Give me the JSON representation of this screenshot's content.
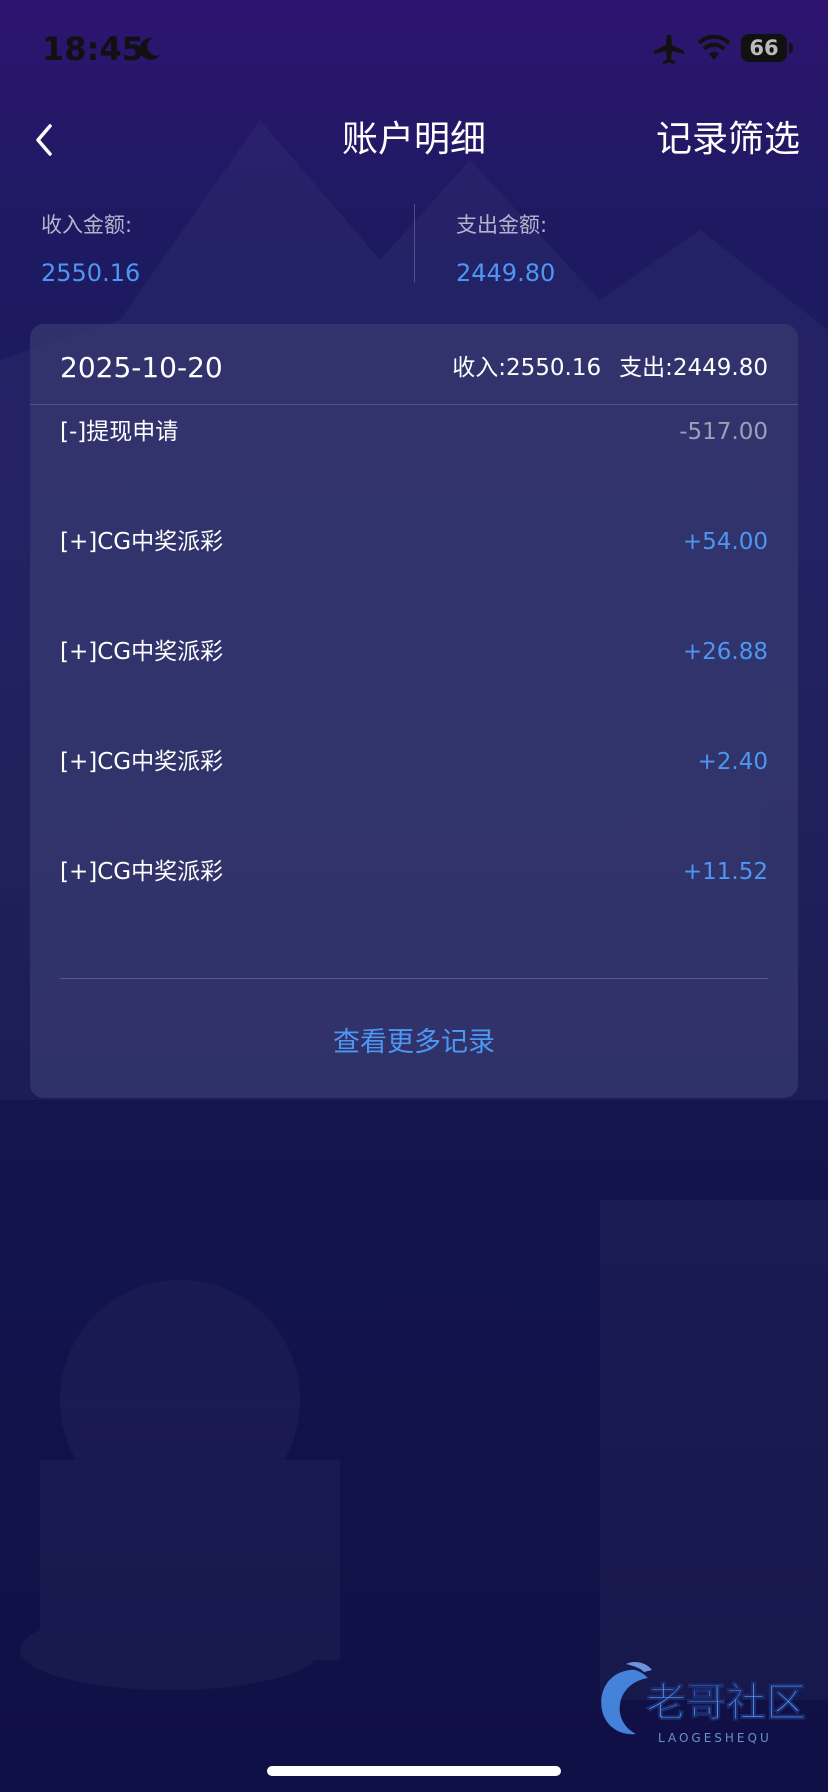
{
  "status_bar": {
    "time": "18:45",
    "battery": "66",
    "icons": [
      "moon-icon",
      "airplane-icon",
      "wifi-icon",
      "battery-icon"
    ]
  },
  "nav": {
    "back_icon": "chevron-left-icon",
    "title": "账户明细",
    "filter_label": "记录筛选"
  },
  "summary": {
    "income_label": "收入金额:",
    "income_value": "2550.16",
    "expense_label": "支出金额:",
    "expense_value": "2449.80"
  },
  "day_card": {
    "date": "2025-10-20",
    "income_total": "收入:2550.16",
    "expense_total": "支出:2449.80",
    "transactions": [
      {
        "label": "[-]提现申请",
        "amount": "-517.00",
        "type": "negative"
      },
      {
        "label": "[+]CG中奖派彩",
        "amount": "+54.00",
        "type": "positive"
      },
      {
        "label": "[+]CG中奖派彩",
        "amount": "+26.88",
        "type": "positive"
      },
      {
        "label": "[+]CG中奖派彩",
        "amount": "+2.40",
        "type": "positive"
      },
      {
        "label": "[+]CG中奖派彩",
        "amount": "+11.52",
        "type": "positive"
      }
    ],
    "more_label": "查看更多记录"
  },
  "watermark": {
    "text": "老哥社区",
    "subtext": "LAOGESHEQU"
  },
  "colors": {
    "accent_blue": "#4d97f3",
    "negative_gray": "#9e9eb6",
    "background_top": "#2e1470",
    "background_bottom": "#0f1045",
    "card_bg": "#383a70"
  }
}
